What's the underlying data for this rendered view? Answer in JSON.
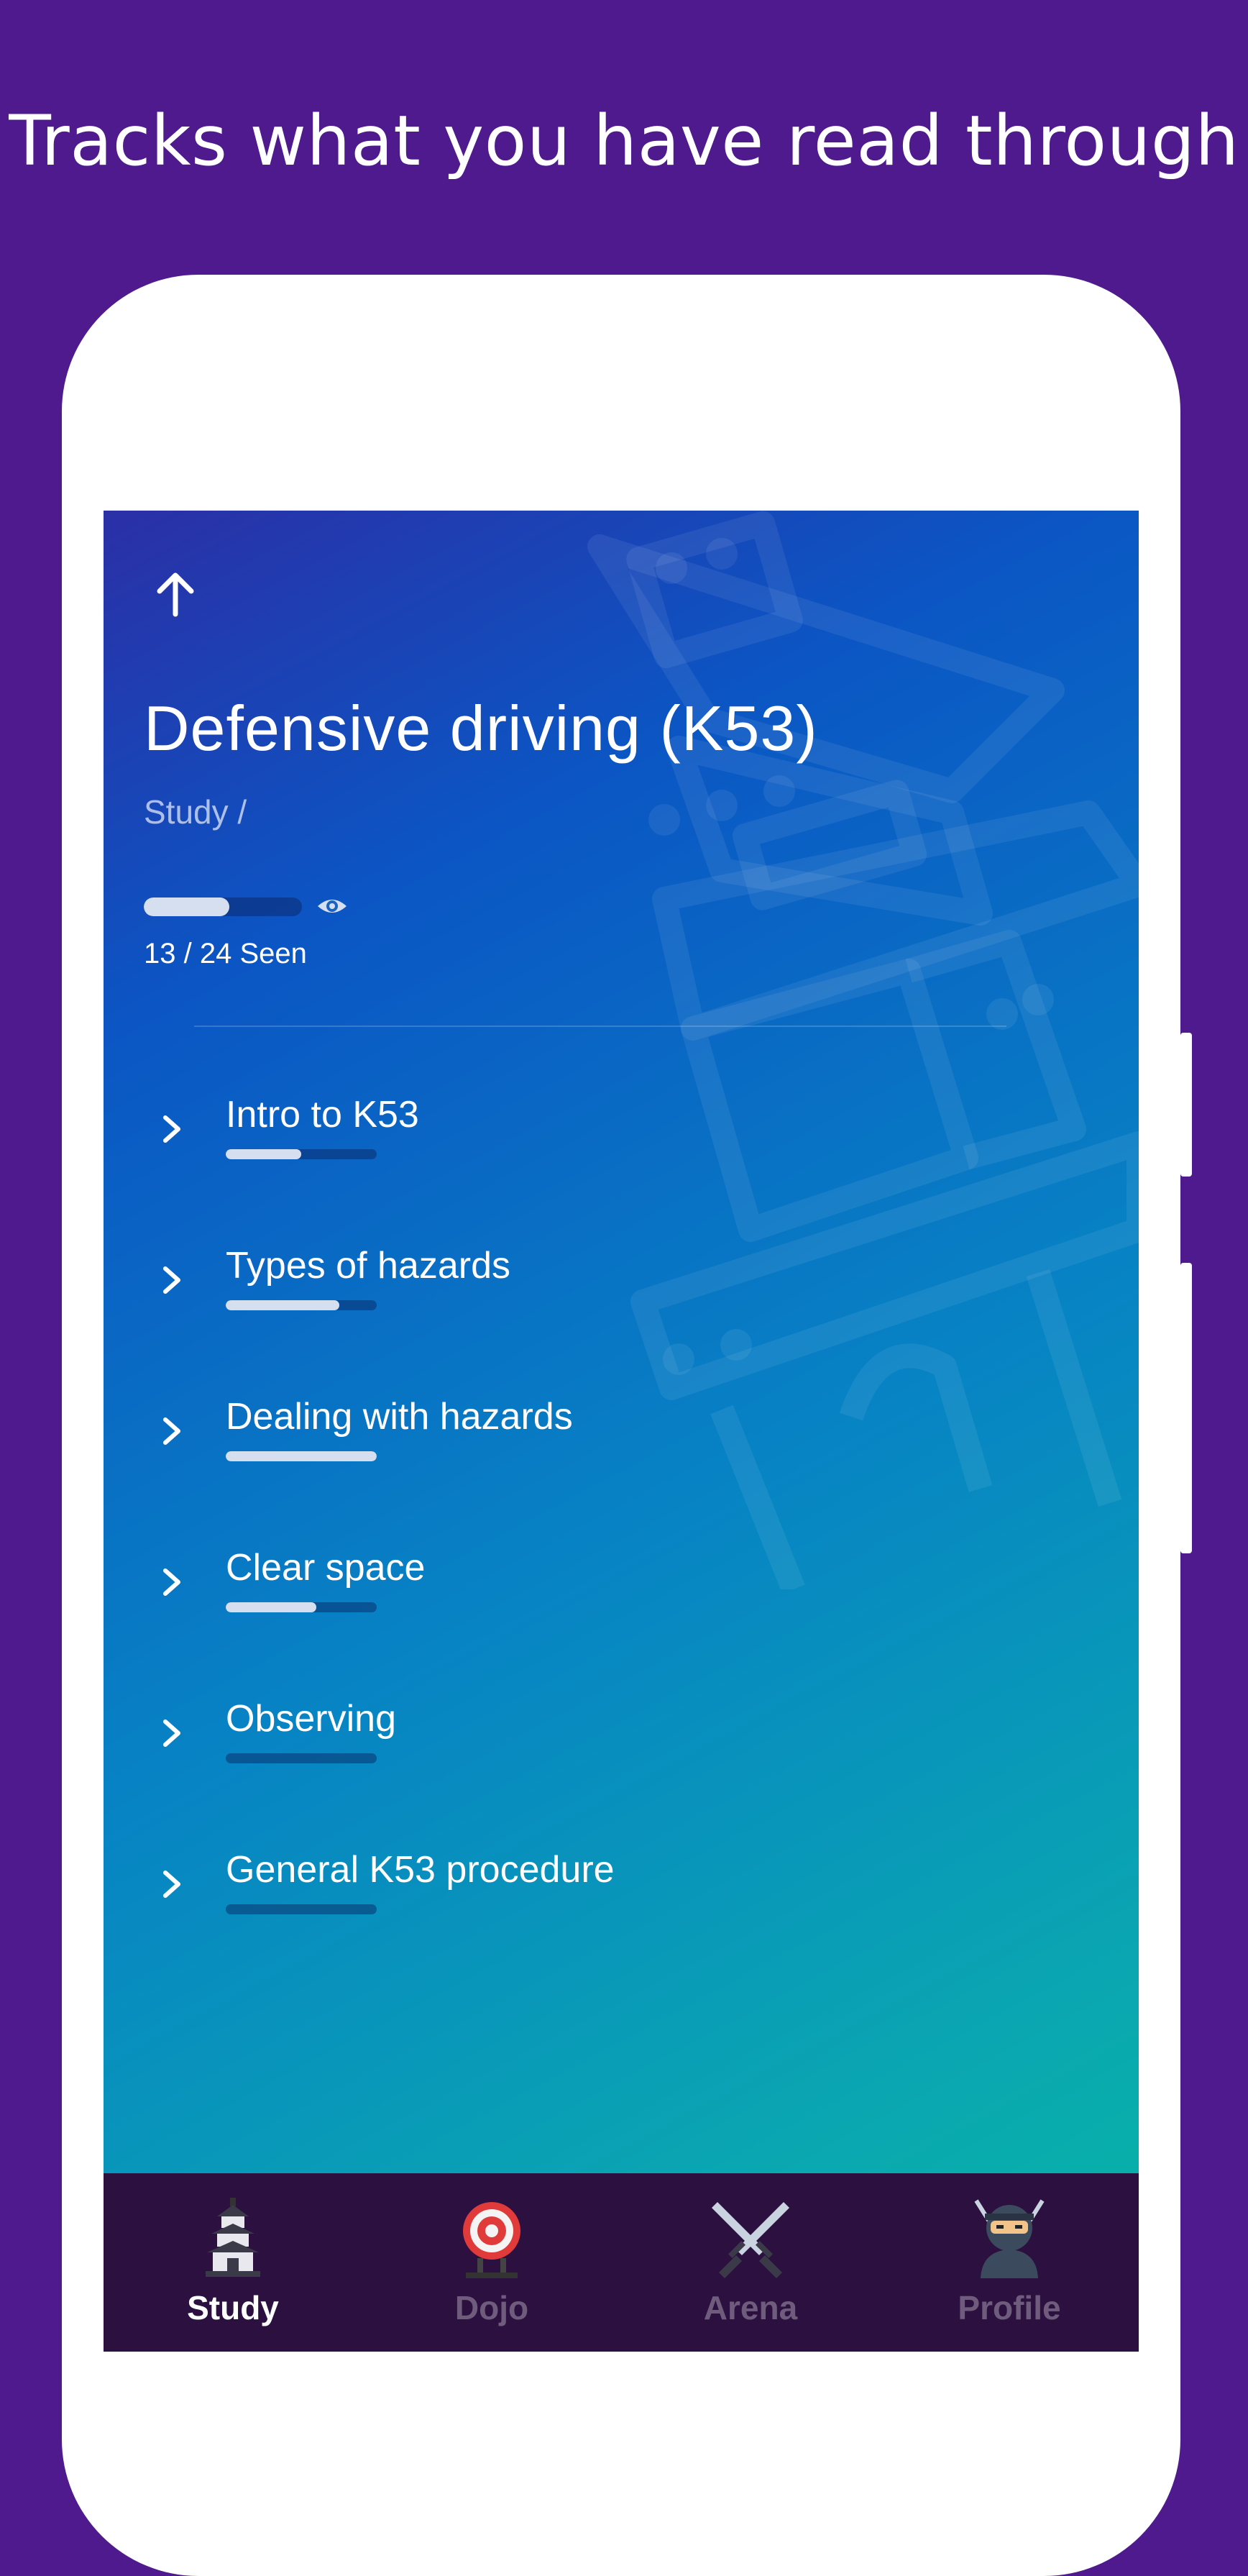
{
  "headline": "Tracks what you have read through",
  "screen": {
    "title": "Defensive driving (K53)",
    "breadcrumb": "Study /",
    "overall_progress": 0.54,
    "seen_label": "13 / 24 Seen",
    "icons": {
      "back": "arrow-up-icon",
      "seen": "eye-icon",
      "watermark": "pagoda-icon"
    }
  },
  "topics": [
    {
      "label": "Intro to K53",
      "progress": 0.5
    },
    {
      "label": "Types of hazards",
      "progress": 0.75
    },
    {
      "label": "Dealing with hazards",
      "progress": 1.0
    },
    {
      "label": "Clear space",
      "progress": 0.6
    },
    {
      "label": "Observing",
      "progress": 0.0
    },
    {
      "label": "General K53 procedure",
      "progress": 0.0
    }
  ],
  "nav": {
    "items": [
      {
        "label": "Study",
        "icon": "pagoda-icon",
        "active": true
      },
      {
        "label": "Dojo",
        "icon": "target-icon",
        "active": false
      },
      {
        "label": "Arena",
        "icon": "crossed-swords-icon",
        "active": false
      },
      {
        "label": "Profile",
        "icon": "ninja-icon",
        "active": false
      }
    ]
  },
  "colors": {
    "background": "#4f1a8d",
    "nav_background": "#2b1040",
    "progress_fill": "#d6dff0"
  }
}
